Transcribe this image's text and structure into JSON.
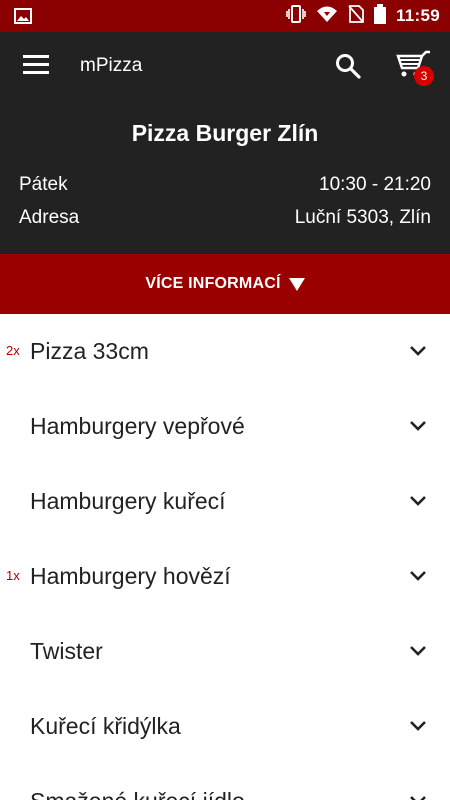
{
  "status_bar": {
    "time": "11:59",
    "icons": [
      "image-icon",
      "vibrate-icon",
      "wifi-icon",
      "no-sim-icon",
      "battery-icon"
    ]
  },
  "app": {
    "title": "mPizza",
    "cart_count": "3"
  },
  "restaurant": {
    "name": "Pizza Burger Zlín",
    "day_label": "Pátek",
    "hours": "10:30 - 21:20",
    "address_label": "Adresa",
    "address": "Luční 5303, Zlín"
  },
  "more_info": {
    "label": "VÍCE INFORMACÍ"
  },
  "categories": [
    {
      "qty": "2x",
      "label": "Pizza 33cm"
    },
    {
      "qty": "",
      "label": "Hamburgery vepřové"
    },
    {
      "qty": "",
      "label": "Hamburgery kuřecí"
    },
    {
      "qty": "1x",
      "label": "Hamburgery hovězí"
    },
    {
      "qty": "",
      "label": "Twister"
    },
    {
      "qty": "",
      "label": "Kuřecí křidýlka"
    },
    {
      "qty": "",
      "label": "Smažené kuřecí jídlo"
    }
  ],
  "colors": {
    "status_bar": "#8b0000",
    "header": "#222222",
    "more_bar": "#9b0000",
    "badge": "#d50000",
    "qty_text": "#b00000"
  }
}
